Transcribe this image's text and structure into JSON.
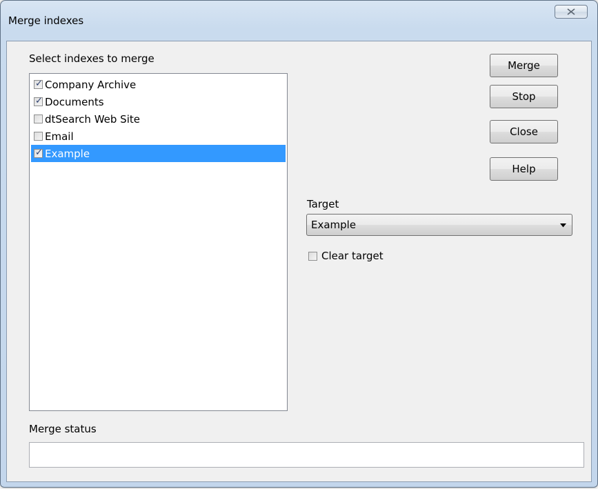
{
  "window": {
    "title": "Merge indexes",
    "close_glyph": "✕"
  },
  "indexes_label": "Select indexes to merge",
  "indexes": [
    {
      "label": "Company Archive",
      "checked": true,
      "selected": false
    },
    {
      "label": "Documents",
      "checked": true,
      "selected": false
    },
    {
      "label": "dtSearch Web Site",
      "checked": false,
      "selected": false
    },
    {
      "label": "Email",
      "checked": false,
      "selected": false
    },
    {
      "label": "Example",
      "checked": true,
      "selected": true
    }
  ],
  "buttons": {
    "merge": "Merge",
    "stop": "Stop",
    "close": "Close",
    "help": "Help"
  },
  "target": {
    "label": "Target",
    "value": "Example"
  },
  "clear_target": {
    "label": "Clear target",
    "checked": false
  },
  "merge_status": {
    "label": "Merge status",
    "value": ""
  },
  "colors": {
    "selection": "#3399ff",
    "check_mark": "#2b3e6e",
    "frame": "#c9dbee"
  },
  "icons": {
    "close": "close-icon",
    "check": "check-icon",
    "dropdown": "chevron-down-icon"
  }
}
